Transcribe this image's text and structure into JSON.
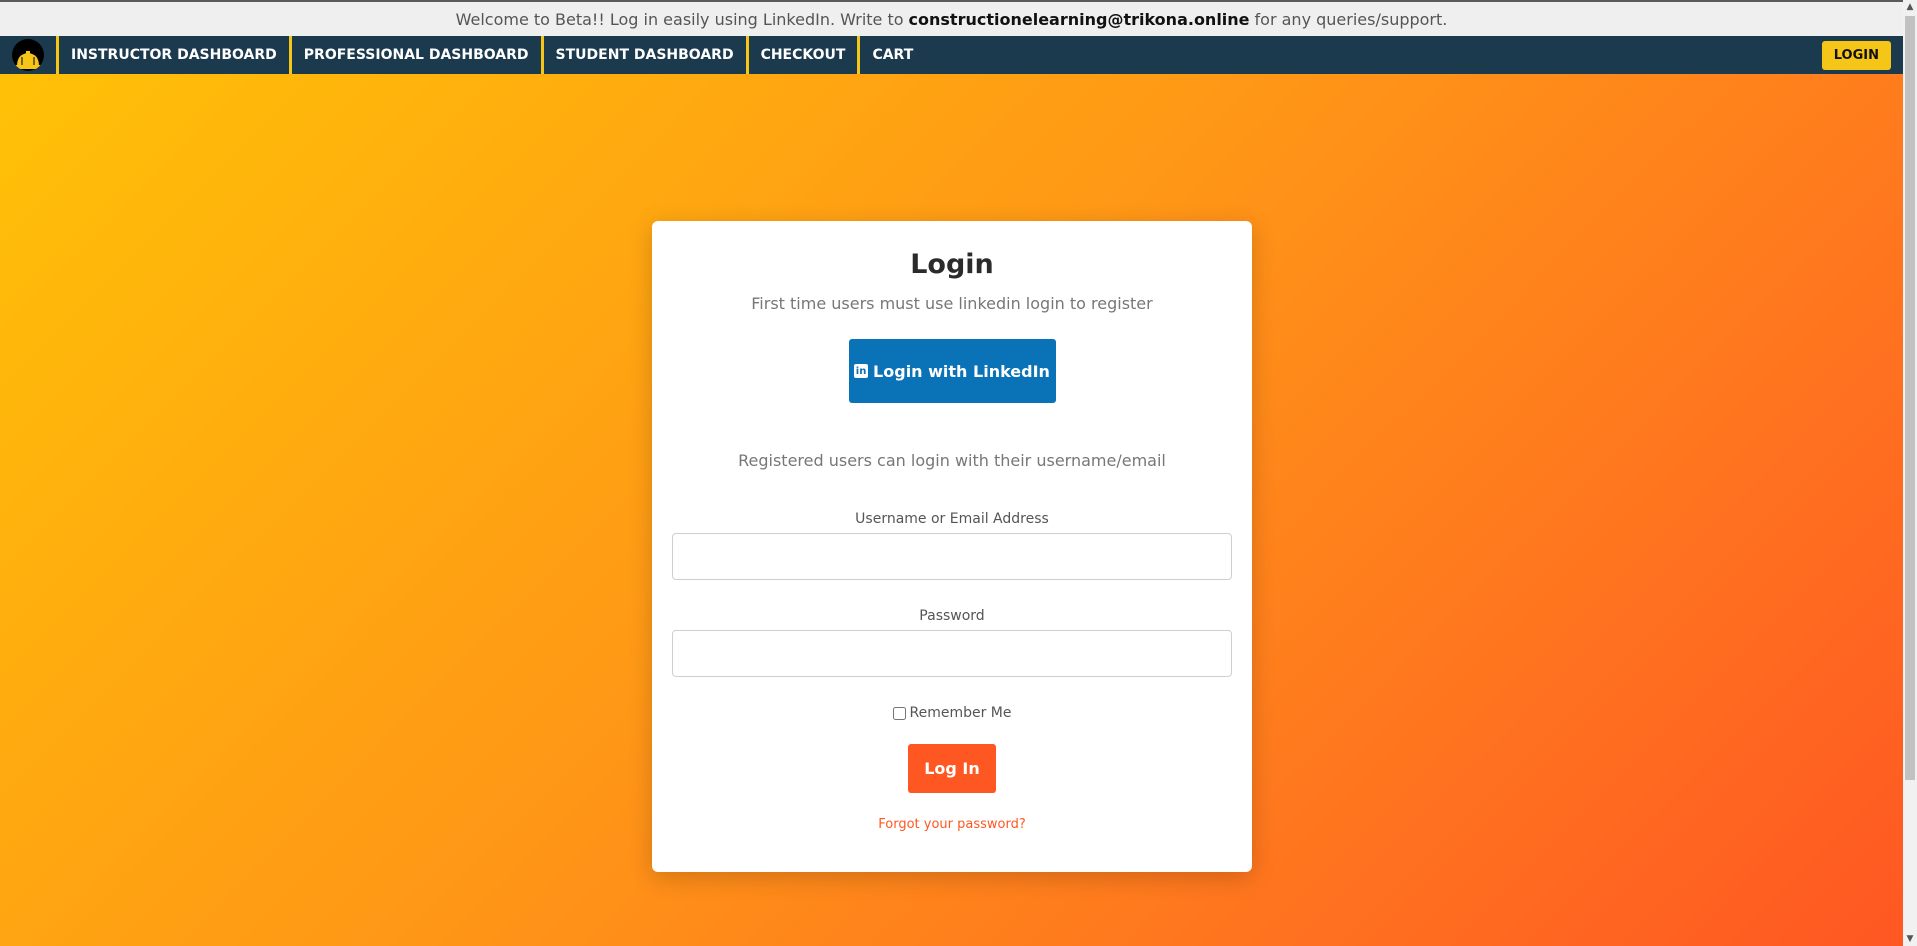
{
  "announcement": {
    "prefix": "Welcome to Beta!! Log in easily using LinkedIn. Write to",
    "email": "constructionelearning@trikona.online",
    "suffix": "for any queries/support."
  },
  "nav": {
    "logo_icon": "hard-hat-icon",
    "items": [
      {
        "label": "INSTRUCTOR DASHBOARD"
      },
      {
        "label": "PROFESSIONAL DASHBOARD"
      },
      {
        "label": "STUDENT DASHBOARD"
      },
      {
        "label": "CHECKOUT"
      },
      {
        "label": "CART"
      }
    ],
    "login_label": "LOGIN"
  },
  "login_card": {
    "title": "Login",
    "subtext": "First time users must use linkedin login to register",
    "linkedin_icon": "linkedin-icon",
    "linkedin_icon_text": "in",
    "linkedin_button": "Login with LinkedIn",
    "registered_text": "Registered users can login with their username/email",
    "username_label": "Username or Email Address",
    "username_value": "",
    "password_label": "Password",
    "password_value": "",
    "remember_label": "Remember Me",
    "submit_label": "Log In",
    "forgot_label": "Forgot your password?"
  },
  "colors": {
    "nav_bg": "#1c3a4d",
    "accent_yellow": "#f5c518",
    "linkedin_blue": "#0a73b7",
    "submit_orange": "#ff5722",
    "gradient_start": "#ffc107",
    "gradient_end": "#ff5722"
  }
}
